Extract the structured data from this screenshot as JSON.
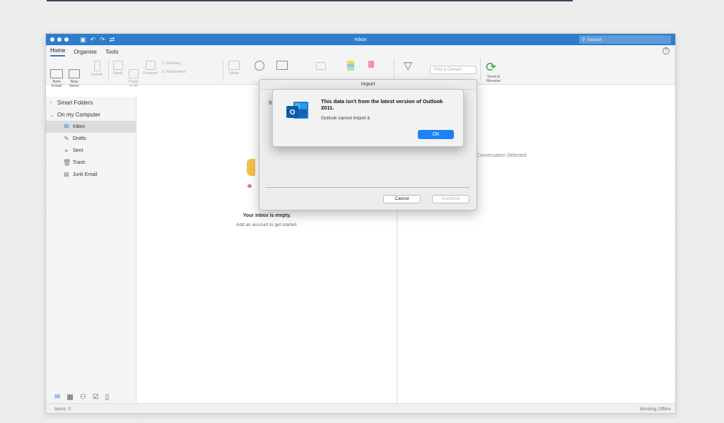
{
  "window": {
    "title": "Inbox",
    "search_placeholder": "Search"
  },
  "ribbon_tabs": [
    "Home",
    "Organise",
    "Tools"
  ],
  "ribbon": {
    "new_email": "New\nEmail",
    "new_items": "New\nItems",
    "delete": "Delete",
    "reply": "Reply",
    "reply_all": "Reply\nto All",
    "forward": "Forward",
    "meeting": "Meeting",
    "attachment": "Attachment",
    "move": "Move",
    "find_contact": "Find a Contact",
    "send_receive": "Send &\nReceive"
  },
  "sidebar": {
    "smart_folders": "Smart Folders",
    "on_my_computer": "On my Computer",
    "folders": [
      {
        "label": "Inbox",
        "icon": "inbox-icon",
        "selected": true
      },
      {
        "label": "Drafts",
        "icon": "drafts-icon",
        "selected": false
      },
      {
        "label": "Sent",
        "icon": "sent-icon",
        "selected": false
      },
      {
        "label": "Trash",
        "icon": "trash-icon",
        "selected": false
      },
      {
        "label": "Junk Email",
        "icon": "junk-icon",
        "selected": false
      }
    ]
  },
  "message_list": {
    "empty_title": "Your inbox is empty.",
    "empty_subtitle": "Add an account to get started."
  },
  "reading_pane": {
    "no_selection": "No Conversation Selected"
  },
  "status_bar": {
    "items": "Items: 0",
    "connection": "Working Offline"
  },
  "import_dialog": {
    "title": "Import",
    "body_text": "Im",
    "cancel": "Cancel",
    "continue": "Continue"
  },
  "alert": {
    "title": "This data isn't from the latest version of Outlook 2011.",
    "message": "Outlook cannot import it.",
    "ok": "OK"
  },
  "colors": {
    "accent": "#2d7dcc",
    "ok_button": "#1a83f5",
    "send_receive": "#3aa43a"
  }
}
